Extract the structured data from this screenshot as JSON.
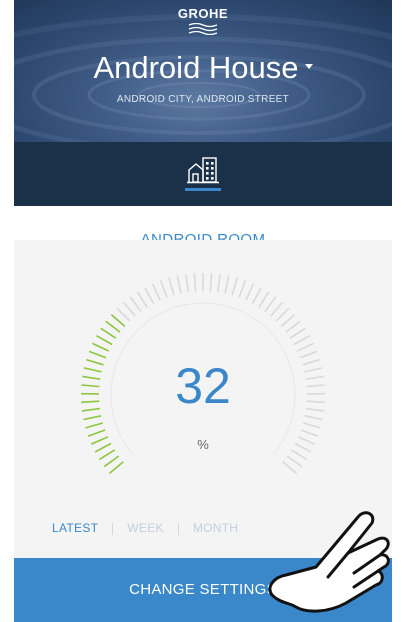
{
  "header": {
    "brand": "GROHE",
    "house_name": "Android House",
    "address": "ANDROID CITY, ANDROID STREET"
  },
  "tabs": {
    "active_icon": "building-icon"
  },
  "room": {
    "name": "ANDROID ROOM"
  },
  "gauge": {
    "value": "32",
    "unit": "%",
    "percent": 32,
    "active_color": "#8dc63f",
    "inactive_color": "#d9d9d9"
  },
  "range_tabs": {
    "latest": "LATEST",
    "week": "WEEK",
    "month": "MONTH"
  },
  "footer": {
    "change_settings": "CHANGE SETTINGS"
  },
  "colors": {
    "accent": "#3a87c9",
    "header_dark": "#1b3149",
    "card_background": "#f4f4f5"
  },
  "overlay": {
    "icon": "pointing-hand-icon"
  }
}
